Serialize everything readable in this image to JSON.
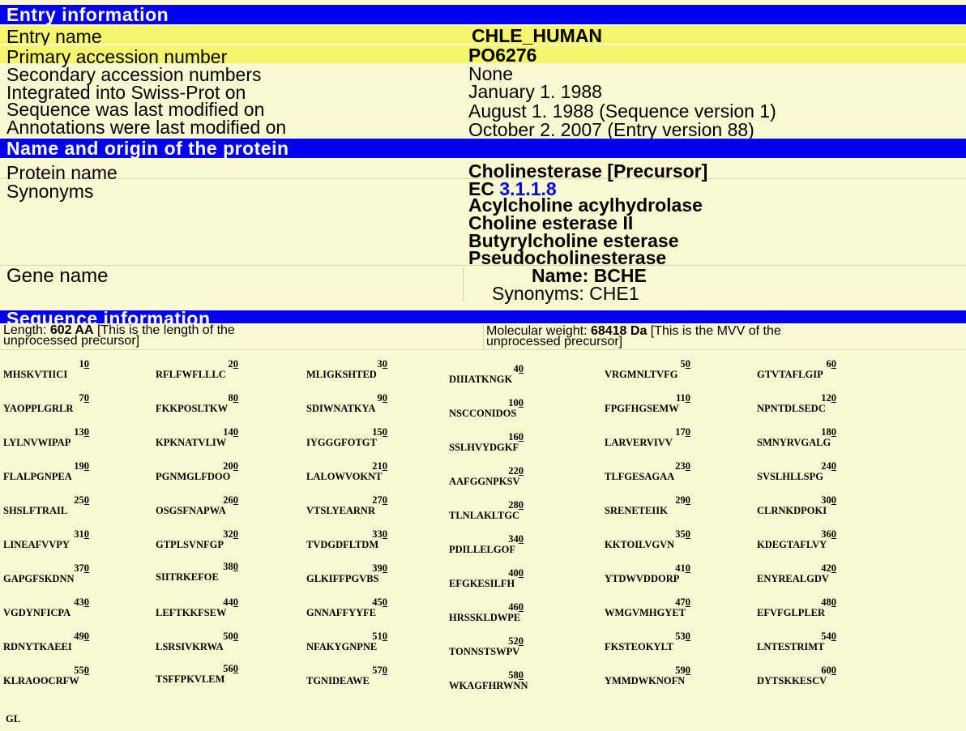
{
  "entry_info": {
    "header": "Entry information",
    "rows": [
      {
        "label": "Entry name",
        "value": "CHLE_HUMAN"
      },
      {
        "label": "Primary accession number",
        "value": "PO6276"
      },
      {
        "label": "Secondary accession numbers",
        "value": "None"
      },
      {
        "label": "Integrated into Swiss-Prot on",
        "value": "January 1. 1988"
      },
      {
        "label": "Sequence was last modified on",
        "value": "August 1. 1988 (Sequence version 1)"
      },
      {
        "label": "Annotations were last modified on",
        "value": "October 2. 2007 (Entry version 88)"
      }
    ]
  },
  "protein": {
    "header": "Name and origin of the protein",
    "name_label": "Protein name",
    "name_value": "Cholinesterase [Precursor]",
    "synonyms_label": "Synonyms",
    "ec_prefix": "EC",
    "ec_number": "3.1.1.8",
    "synonyms": [
      "Acylcholine acylhydrolase",
      "Choline esterase II",
      "Butyrylcholine esterase",
      "Pseudocholinesterase"
    ],
    "gene_label": "Gene name",
    "gene_name": "Name: BCHE",
    "gene_synonyms": "Synonyms: CHE1"
  },
  "sequence": {
    "header": "Sequence information",
    "length_prefix": "Length:",
    "length_value": "602 AA",
    "length_note": "[This is the length of the",
    "length_note2": "unprocessed precursor]",
    "mw_prefix": "Molecular weight:",
    "mw_value": "68418 Da",
    "mw_note": "[This is the MVV of the",
    "mw_note2": "unprocessed precursor]",
    "blocks": [
      {
        "n": "10",
        "s": "MHSKVTIICI"
      },
      {
        "n": "20",
        "s": "RFLFWFLLLC"
      },
      {
        "n": "30",
        "s": "MLIGKSHTED"
      },
      {
        "n": "40",
        "s": "DIIIATKNGK"
      },
      {
        "n": "50",
        "s": "VRGMNLTVFG"
      },
      {
        "n": "60",
        "s": "GTVTAFLGIP"
      },
      {
        "n": "70",
        "s": "YAOPPLGRLR"
      },
      {
        "n": "80",
        "s": "FKKPOSLTKW"
      },
      {
        "n": "90",
        "s": "SDIWNATKYA"
      },
      {
        "n": "100",
        "s": "NSCCONIDOS"
      },
      {
        "n": "110",
        "s": "FPGFHGSEMW"
      },
      {
        "n": "120",
        "s": "NPNTDLSEDC"
      },
      {
        "n": "130",
        "s": "LYLNVWIPAP"
      },
      {
        "n": "140",
        "s": "KPKNATVLIW"
      },
      {
        "n": "150",
        "s": "IYGGGFOTGT"
      },
      {
        "n": "160",
        "s": "SSLHVYDGKF"
      },
      {
        "n": "170",
        "s": "LARVERVIVV"
      },
      {
        "n": "180",
        "s": "SMNYRVGALG"
      },
      {
        "n": "190",
        "s": "FLALPGNPEA"
      },
      {
        "n": "200",
        "s": "PGNMGLFDOO"
      },
      {
        "n": "210",
        "s": "LALOWVOKNT"
      },
      {
        "n": "220",
        "s": "AAFGGNPKSV"
      },
      {
        "n": "230",
        "s": "TLFGESAGAA"
      },
      {
        "n": "240",
        "s": "SVSLHLLSPG"
      },
      {
        "n": "250",
        "s": "SHSLFTRAIL"
      },
      {
        "n": "260",
        "s": "OSGSFNAPWA"
      },
      {
        "n": "270",
        "s": "VTSLYEARNR"
      },
      {
        "n": "280",
        "s": "TLNLAKLTGC"
      },
      {
        "n": "290",
        "s": "SRENETEIIK"
      },
      {
        "n": "300",
        "s": "CLRNKDPOKI"
      },
      {
        "n": "310",
        "s": "LINEAFVVPY"
      },
      {
        "n": "320",
        "s": "GTPLSVNFGP"
      },
      {
        "n": "330",
        "s": "TVDGDFLTDM"
      },
      {
        "n": "340",
        "s": "PDILLELGOF"
      },
      {
        "n": "350",
        "s": "KKTOILVGVN"
      },
      {
        "n": "360",
        "s": "KDEGTAFLVY"
      },
      {
        "n": "370",
        "s": "GAPGFSKDNN"
      },
      {
        "n": "380",
        "s": "SIITRKEFOE"
      },
      {
        "n": "390",
        "s": "GLKIFFPGVBS"
      },
      {
        "n": "400",
        "s": "EFGKESILFH"
      },
      {
        "n": "410",
        "s": "YTDWVDDORP"
      },
      {
        "n": "420",
        "s": "ENYREALGDV"
      },
      {
        "n": "430",
        "s": "VGDYNFICPA"
      },
      {
        "n": "440",
        "s": "LEFTKKFSEW"
      },
      {
        "n": "450",
        "s": "GNNAFFYYFE"
      },
      {
        "n": "460",
        "s": "HRSSKLDWPE"
      },
      {
        "n": "470",
        "s": "WMGVMHGYET"
      },
      {
        "n": "480",
        "s": "EFVFGLPLER"
      },
      {
        "n": "490",
        "s": "RDNYTKAEEI"
      },
      {
        "n": "500",
        "s": "LSRSIVKRWA"
      },
      {
        "n": "510",
        "s": "NFAKYGNPNE"
      },
      {
        "n": "520",
        "s": "TONNSTSWPV"
      },
      {
        "n": "530",
        "s": "FKSTEOKYLT"
      },
      {
        "n": "540",
        "s": "LNTESTRIMT"
      },
      {
        "n": "550",
        "s": "KLRAOOCRFW"
      },
      {
        "n": "560",
        "s": "TSFFPKVLEM"
      },
      {
        "n": "570",
        "s": "TGNIDEAWE"
      },
      {
        "n": "580",
        "s": "WKAGFHRWNN"
      },
      {
        "n": "590",
        "s": "YMMDWKNOFN"
      },
      {
        "n": "600",
        "s": "DYTSKKESCV"
      }
    ],
    "tail": "GL"
  },
  "colors": {
    "header_bg": "#0000ee",
    "page_bg": "#fafad2",
    "highlight": "#f6f56b",
    "link": "#0000ee"
  }
}
